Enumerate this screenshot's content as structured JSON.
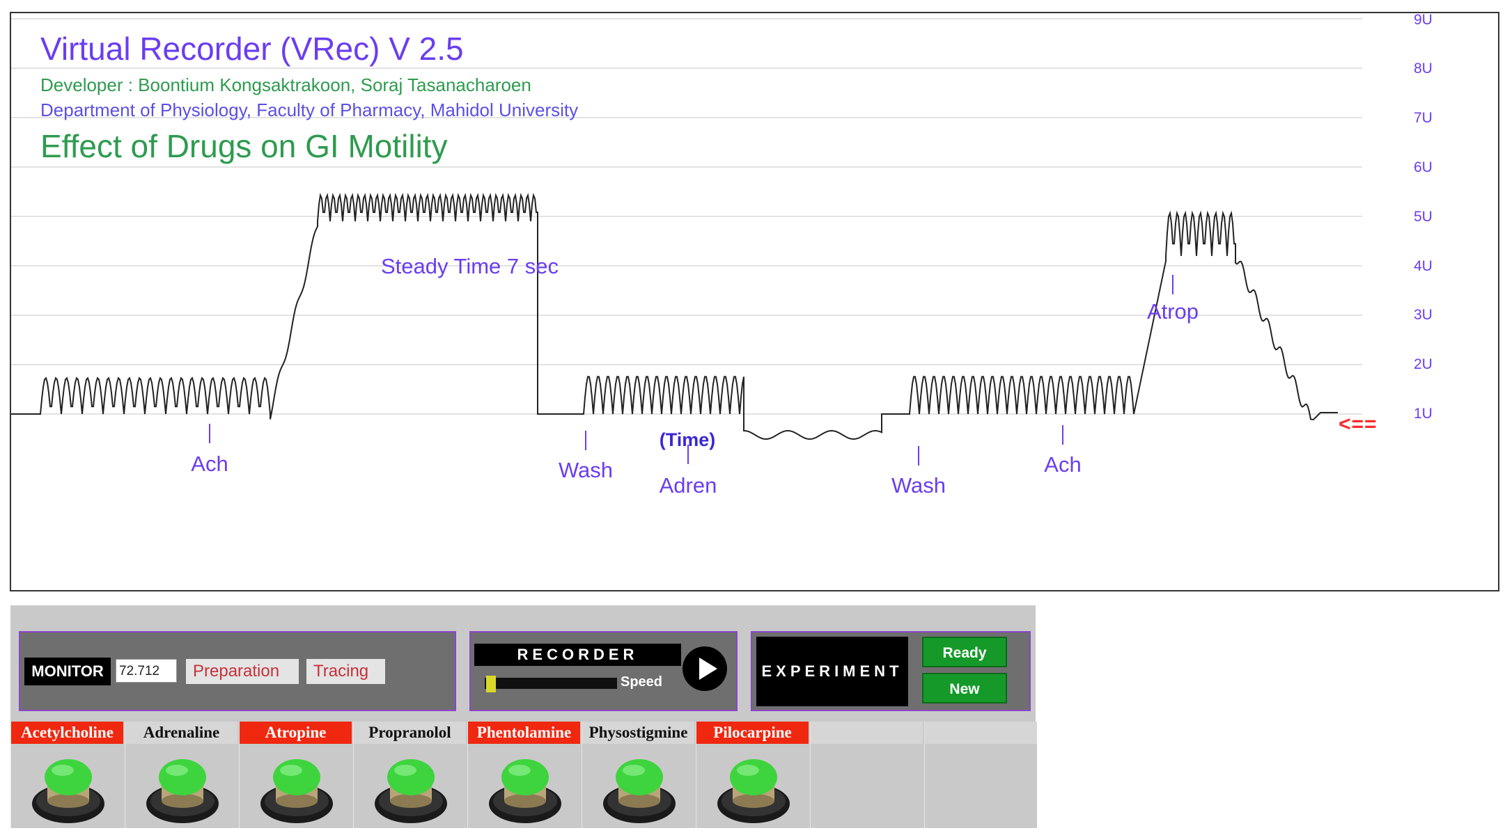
{
  "recorder_chart": {
    "app_title": "Virtual Recorder (VRec) V 2.5",
    "developer": "Developer : Boontium Kongsaktrakoon, Soraj Tasanacharoen",
    "department": "Department of Physiology, Faculty of Pharmacy, Mahidol University",
    "experiment_title": "Effect of Drugs on GI Motility",
    "steady_note": "Steady Time 7 sec",
    "time_label": "(Time)",
    "pointer": "<==",
    "y_ticks": [
      "1U",
      "2U",
      "3U",
      "4U",
      "5U",
      "6U",
      "7U",
      "8U",
      "9U"
    ],
    "drug_marks": [
      {
        "label": "Ach"
      },
      {
        "label": "Wash"
      },
      {
        "label": "Adren"
      },
      {
        "label": "Wash"
      },
      {
        "label": "Ach"
      },
      {
        "label": "Atrop"
      }
    ],
    "colors": {
      "trace": "#222222",
      "label": "#6a3df0",
      "gridline": "#e2e2e2",
      "pointer": "#ff2a2a"
    }
  },
  "monitor": {
    "label": "MONITOR",
    "value": "72.712",
    "preparation_label": "Preparation",
    "tracing_label": "Tracing"
  },
  "recorder": {
    "label": "RECORDER",
    "speed_label": "Speed",
    "play_icon": "play-icon"
  },
  "experiment": {
    "label": "EXPERIMENT",
    "ready_label": "Ready",
    "new_label": "New"
  },
  "drugs": [
    {
      "name": "Acetylcholine",
      "color": "red"
    },
    {
      "name": "Adrenaline",
      "color": "plain"
    },
    {
      "name": "Atropine",
      "color": "red"
    },
    {
      "name": "Propranolol",
      "color": "plain"
    },
    {
      "name": "Phentolamine",
      "color": "red"
    },
    {
      "name": "Physostigmine",
      "color": "plain"
    },
    {
      "name": "Pilocarpine",
      "color": "red"
    }
  ]
}
